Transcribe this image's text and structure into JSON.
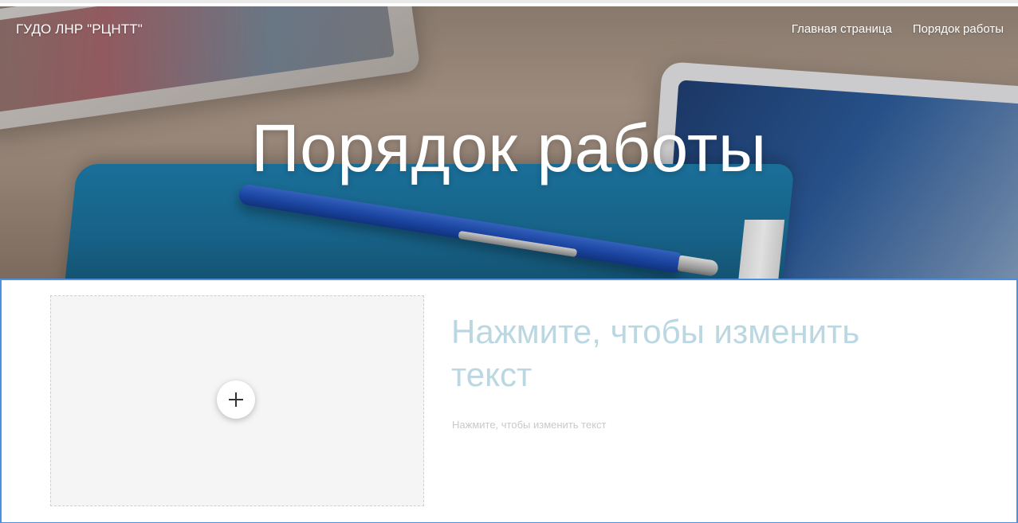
{
  "header": {
    "brand": "ГУДО ЛНР \"РЦНТТ\"",
    "nav": [
      {
        "label": "Главная страница"
      },
      {
        "label": "Порядок работы"
      }
    ]
  },
  "hero": {
    "title": "Порядок работы"
  },
  "content": {
    "image_placeholder": {
      "icon": "plus-icon"
    },
    "heading": "Нажмите, чтобы изменить текст",
    "body": "Нажмите, чтобы изменить текст"
  },
  "colors": {
    "accent_border": "#4f8fe0",
    "heading_placeholder": "#bad7e2",
    "body_placeholder": "#c9c9c9"
  }
}
